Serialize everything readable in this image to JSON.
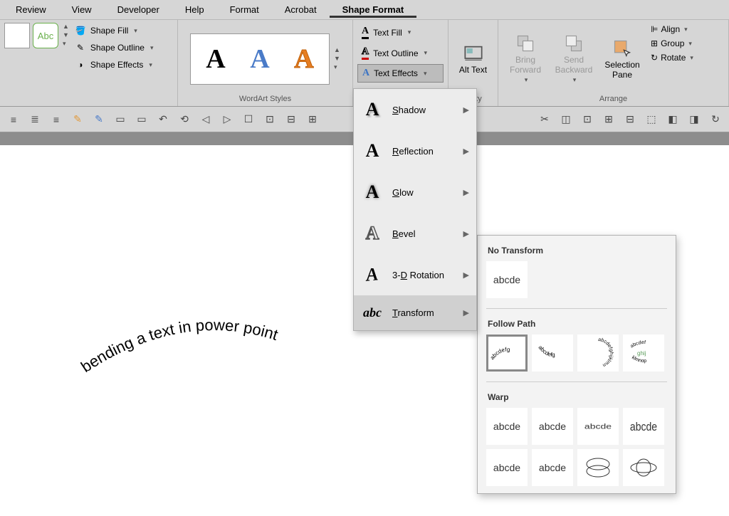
{
  "menu": [
    "Review",
    "View",
    "Developer",
    "Help",
    "Format",
    "Acrobat",
    "Shape Format"
  ],
  "menu_active_index": 6,
  "shape_styles": {
    "abc": "Abc",
    "fill": "Shape Fill",
    "outline": "Shape Outline",
    "effects": "Shape Effects"
  },
  "wordart": {
    "group_label": "WordArt Styles"
  },
  "text_styles": {
    "fill": "Text Fill",
    "outline": "Text Outline",
    "effects": "Text Effects"
  },
  "accessibility": {
    "alt_text": "Alt Text",
    "group_cut": "ibility"
  },
  "arrange": {
    "bring_forward": "Bring Forward",
    "send_backward": "Send Backward",
    "selection_pane": "Selection Pane",
    "align": "Align",
    "group_btn": "Group",
    "rotate": "Rotate",
    "group_label": "Arrange"
  },
  "fx_menu": {
    "shadow": "Shadow",
    "reflection": "Reflection",
    "glow": "Glow",
    "bevel": "Bevel",
    "rotation_3d": "3-D Rotation",
    "transform": "Transform",
    "abc_icon": "abc"
  },
  "transform_panel": {
    "no_transform_title": "No Transform",
    "no_transform_sample": "abcde",
    "follow_path_title": "Follow Path",
    "warp_title": "Warp",
    "warp_sample": "abcde"
  },
  "canvas_text": "bending a text in power point"
}
